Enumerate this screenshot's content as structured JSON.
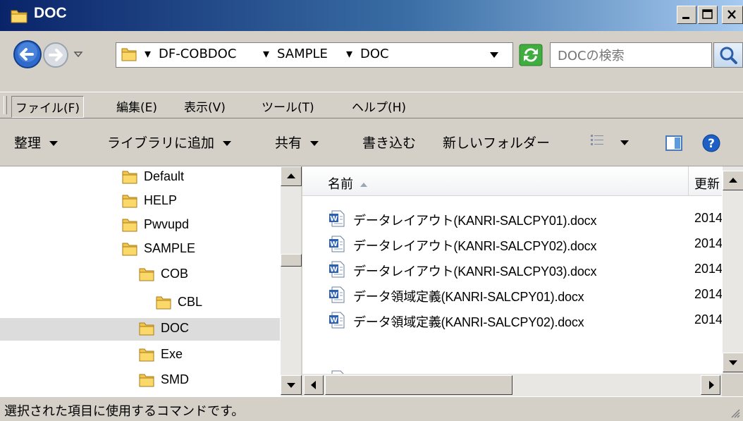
{
  "window": {
    "title": "DOC"
  },
  "address": {
    "crumbs": [
      "DF-COBDOC",
      "SAMPLE",
      "DOC"
    ],
    "search_placeholder": "DOCの検索"
  },
  "menu": {
    "items": [
      "ファイル(F)",
      "編集(E)",
      "表示(V)",
      "ツール(T)",
      "ヘルプ(H)"
    ]
  },
  "toolbar": {
    "organize": "整理",
    "add_to_library": "ライブラリに追加",
    "share": "共有",
    "burn": "書き込む",
    "new_folder": "新しいフォルダー"
  },
  "tree": {
    "items": [
      {
        "label": "Default",
        "selected": false
      },
      {
        "label": "HELP",
        "selected": false
      },
      {
        "label": "Pwvupd",
        "selected": false
      },
      {
        "label": "SAMPLE",
        "selected": false
      },
      {
        "label": "COB",
        "selected": false
      },
      {
        "label": "CBL",
        "selected": false
      },
      {
        "label": "DOC",
        "selected": true
      },
      {
        "label": "Exe",
        "selected": false
      },
      {
        "label": "SMD",
        "selected": false
      }
    ]
  },
  "files": {
    "columns": {
      "name": "名前",
      "date": "更新"
    },
    "rows": [
      {
        "name": "データレイアウト(KANRI-SALCPY01).docx",
        "date": "2014"
      },
      {
        "name": "データレイアウト(KANRI-SALCPY02).docx",
        "date": "2014"
      },
      {
        "name": "データレイアウト(KANRI-SALCPY03).docx",
        "date": "2014"
      },
      {
        "name": "データ領域定義(KANRI-SALCPY01).docx",
        "date": "2014"
      },
      {
        "name": "データ領域定義(KANRI-SALCPY02).docx",
        "date": "2014"
      }
    ]
  },
  "status": {
    "text": "選択された項目に使用するコマンドです。"
  },
  "colors": {
    "title_bar_start": "#0a246a",
    "title_bar_end": "#a6caf0",
    "chrome": "#d4d0c8",
    "selection": "#dcdcdc",
    "folder": "#e8b84a"
  },
  "icons": [
    "folder-icon",
    "back-icon",
    "forward-icon",
    "refresh-icon",
    "search-icon",
    "word-doc-icon",
    "view-icon",
    "preview-pane-icon",
    "help-icon"
  ]
}
